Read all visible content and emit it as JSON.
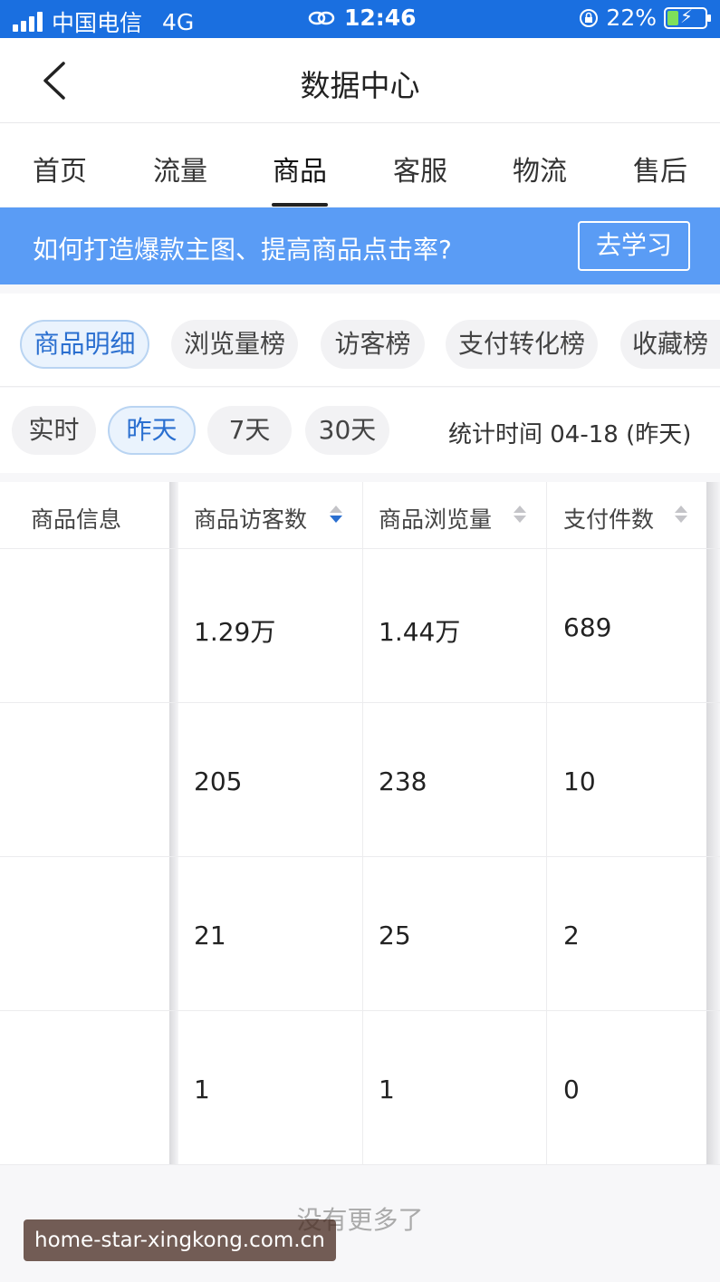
{
  "status_bar": {
    "carrier": "中国电信",
    "network": "4G",
    "time": "12:46",
    "battery": "22%"
  },
  "nav": {
    "title": "数据中心"
  },
  "tabs": [
    {
      "label": "首页"
    },
    {
      "label": "流量"
    },
    {
      "label": "商品"
    },
    {
      "label": "客服"
    },
    {
      "label": "物流"
    },
    {
      "label": "售后"
    }
  ],
  "banner": {
    "text": "如何打造爆款主图、提高商品点击率?",
    "button": "去学习"
  },
  "rank_chips": [
    {
      "label": "商品明细"
    },
    {
      "label": "浏览量榜"
    },
    {
      "label": "访客榜"
    },
    {
      "label": "支付转化榜"
    },
    {
      "label": "收藏榜"
    }
  ],
  "period_chips": [
    {
      "label": "实时"
    },
    {
      "label": "昨天"
    },
    {
      "label": "7天"
    },
    {
      "label": "30天"
    }
  ],
  "stat_time": "统计时间 04-18 (昨天)",
  "table": {
    "headers": [
      "商品信息",
      "商品访客数",
      "商品浏览量",
      "支付件数"
    ],
    "rows": [
      [
        "",
        "1.29万",
        "1.44万",
        "689"
      ],
      [
        "",
        "205",
        "238",
        "10"
      ],
      [
        "",
        "21",
        "25",
        "2"
      ],
      [
        "",
        "1",
        "1",
        "0"
      ]
    ]
  },
  "footer": {
    "no_more": "没有更多了"
  },
  "watermark": "home-star-xingkong.com.cn",
  "colors": {
    "brand_blue": "#1a6fe0",
    "banner_blue": "#5a9cf5",
    "active_chip": "#2a6fd0"
  }
}
